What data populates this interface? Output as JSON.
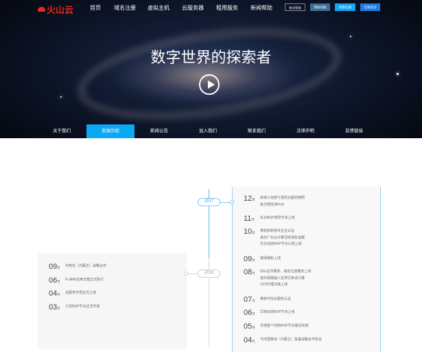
{
  "header": {
    "logo": "火山云",
    "nav": [
      "首页",
      "域名注册",
      "虚拟主机",
      "云服务器",
      "租用服务",
      "新闻帮助"
    ],
    "buttons": [
      "会员登录",
      "帮助问题",
      "免费注册",
      "在线支付"
    ]
  },
  "hero": {
    "title": "数字世界的探索者",
    "icon": "play-icon"
  },
  "subnav": {
    "items": [
      "关于我们",
      "发展历程",
      "新闻公告",
      "加入我们",
      "联系我们",
      "法律声明",
      "友情链接"
    ],
    "active": "发展历程"
  },
  "colors": {
    "accent": "#0aa8f5",
    "brand": "#e8291d"
  },
  "timeline": {
    "month_unit": "月",
    "y2017": {
      "year": "2017",
      "items": [
        {
          "month": "12",
          "lines": [
            "获得工信部下发的云服务牌照",
            "官方网支持IPv6"
          ]
        },
        {
          "month": "11",
          "lines": [
            "东北BGP高防节点上线"
          ]
        },
        {
          "month": "10",
          "lines": [
            "荣获高新技术企业认证",
            "承办广东云计算羽毛球友谊赛",
            "华北动态BGP节点公测上线"
          ]
        },
        {
          "month": "09",
          "lines": [
            "官网焕新上线"
          ]
        },
        {
          "month": "08",
          "lines": [
            "SSL证书服务、域名注册服务上线",
            "境外网络输入及学历参试计算",
            "CPS代理功能上线"
          ]
        },
        {
          "month": "07",
          "lines": [
            "荣获可信云服务认证"
          ]
        },
        {
          "month": "06",
          "lines": [
            "华南动态BGP节点上线"
          ]
        },
        {
          "month": "05",
          "lines": [
            "华南首个动态BGP节点建设完成"
          ]
        },
        {
          "month": "04",
          "lines": [
            "与中国移动（内蒙古）签署战略合作协议"
          ]
        }
      ]
    },
    "y2016": {
      "year": "2016",
      "items": [
        {
          "month": "09",
          "lines": [
            "与电信（内蒙古）战略合作"
          ]
        },
        {
          "month": "06",
          "lines": [
            "FLARE应用方案正式执行"
          ]
        },
        {
          "month": "04",
          "lines": [
            "云服务市场正式上线"
          ]
        },
        {
          "month": "03",
          "lines": [
            "江苏BGP节点正式开放"
          ]
        }
      ]
    }
  }
}
